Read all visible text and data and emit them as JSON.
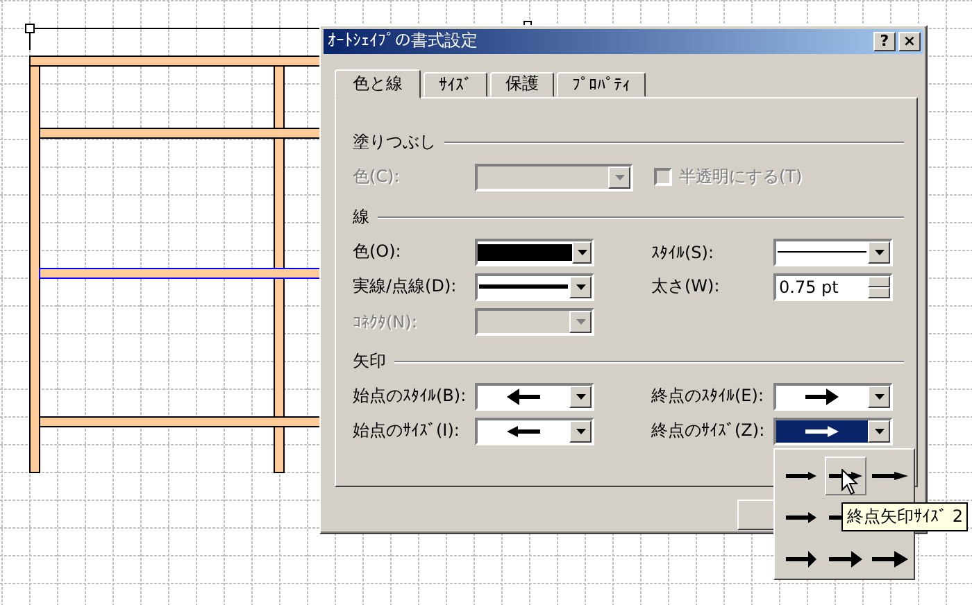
{
  "dialog": {
    "title": "ｵｰﾄｼｪｲﾌﾟの書式設定",
    "help_button": "?",
    "close_button": "×",
    "tabs": [
      {
        "label": "色と線",
        "selected": true
      },
      {
        "label": "ｻｲｽﾞ",
        "selected": false
      },
      {
        "label": "保護",
        "selected": false
      },
      {
        "label": "ﾌﾟﾛﾊﾟﾃｨ",
        "selected": false
      }
    ],
    "sections": [
      {
        "heading": "塗りつぶし",
        "rows": [
          [
            {
              "label": "色(C):",
              "kind": "wide-empty",
              "disabled": true,
              "selected": false
            },
            {
              "label": "半透明にする(T)",
              "kind": "checkbox",
              "checked": false,
              "disabled": true
            }
          ]
        ]
      },
      {
        "heading": "線",
        "rows": [
          [
            {
              "label": "色(O):",
              "kind": "color",
              "disabled": false,
              "selected": false
            },
            {
              "label": "ｽﾀｲﾙ(S):",
              "kind": "thin-line",
              "disabled": false,
              "selected": false
            }
          ],
          [
            {
              "label": "実線/点線(D):",
              "kind": "line",
              "disabled": false,
              "selected": false
            },
            {
              "label": "太さ(W):",
              "kind": "spin",
              "value": "0.75 pt",
              "disabled": false
            }
          ],
          [
            {
              "label": "ｺﾈｸﾀ(N):",
              "kind": "empty",
              "disabled": true,
              "selected": false
            }
          ]
        ]
      },
      {
        "heading": "矢印",
        "rows": [
          [
            {
              "label": "始点のｽﾀｲﾙ(B):",
              "kind": "arrow-left",
              "disabled": false,
              "selected": false
            },
            {
              "label": "終点のｽﾀｲﾙ(E):",
              "kind": "arrow-right",
              "disabled": false,
              "selected": false
            }
          ],
          [
            {
              "label": "始点のｻｲｽﾞ(I):",
              "kind": "arrow-left-small",
              "disabled": false,
              "selected": false
            },
            {
              "label": "終点のｻｲｽﾞ(Z):",
              "kind": "arrow-right-small",
              "disabled": false,
              "selected": true
            }
          ]
        ]
      }
    ],
    "buttons": [
      {
        "kind": "covered"
      }
    ]
  },
  "size_popup": {
    "options": [
      {
        "hovered": false
      },
      {
        "hovered": true
      },
      {
        "hovered": false
      },
      {
        "hovered": false
      },
      {
        "hovered": false
      },
      {
        "hovered": false
      },
      {
        "hovered": false
      },
      {
        "hovered": false
      }
    ],
    "tooltip": "終点矢印ｻｲｽﾞ 2"
  }
}
